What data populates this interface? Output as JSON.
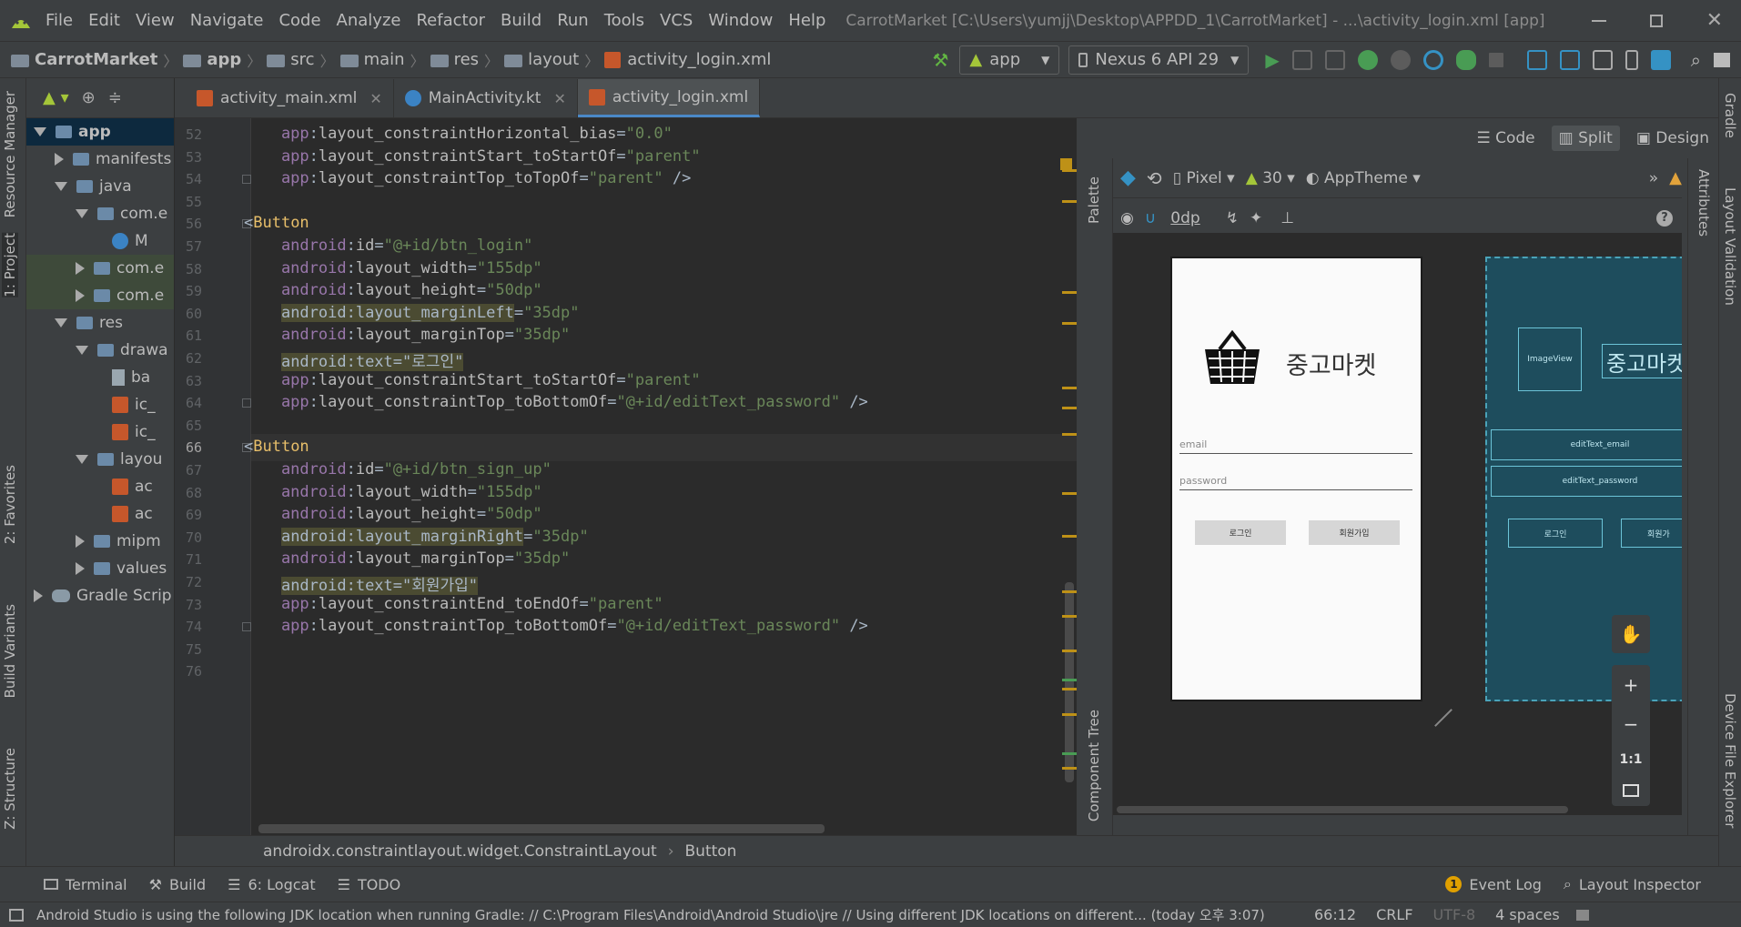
{
  "menu": {
    "items": [
      "File",
      "Edit",
      "View",
      "Navigate",
      "Code",
      "Analyze",
      "Refactor",
      "Build",
      "Run",
      "Tools",
      "VCS",
      "Window",
      "Help"
    ],
    "window_title": "CarrotMarket [C:\\Users\\yumjj\\Desktop\\APPDD_1\\CarrotMarket] - ...\\activity_login.xml [app]"
  },
  "breadcrumb": [
    "CarrotMarket",
    "app",
    "src",
    "main",
    "res",
    "layout",
    "activity_login.xml"
  ],
  "run_config": {
    "module": "app",
    "device": "Nexus 6 API 29"
  },
  "project": {
    "items": [
      {
        "label": "app",
        "indent": 0,
        "tri": "down",
        "icon": "folder",
        "selected": true
      },
      {
        "label": "manifests",
        "indent": 1,
        "tri": "right",
        "icon": "folder"
      },
      {
        "label": "java",
        "indent": 1,
        "tri": "down",
        "icon": "folder"
      },
      {
        "label": "com.e",
        "indent": 2,
        "tri": "down",
        "icon": "folder"
      },
      {
        "label": "M",
        "indent": 3,
        "tri": "none",
        "icon": "kotlin"
      },
      {
        "label": "com.e",
        "indent": 2,
        "tri": "right",
        "icon": "folder",
        "shade": true
      },
      {
        "label": "com.e",
        "indent": 2,
        "tri": "right",
        "icon": "folder",
        "shade": true
      },
      {
        "label": "res",
        "indent": 1,
        "tri": "down",
        "icon": "folder"
      },
      {
        "label": "drawa",
        "indent": 2,
        "tri": "down",
        "icon": "folder"
      },
      {
        "label": "ba",
        "indent": 3,
        "tri": "none",
        "icon": "file"
      },
      {
        "label": "ic_",
        "indent": 3,
        "tri": "none",
        "icon": "xml"
      },
      {
        "label": "ic_",
        "indent": 3,
        "tri": "none",
        "icon": "xml"
      },
      {
        "label": "layou",
        "indent": 2,
        "tri": "down",
        "icon": "folder"
      },
      {
        "label": "ac",
        "indent": 3,
        "tri": "none",
        "icon": "xml"
      },
      {
        "label": "ac",
        "indent": 3,
        "tri": "none",
        "icon": "xml"
      },
      {
        "label": "mipm",
        "indent": 2,
        "tri": "right",
        "icon": "folder"
      },
      {
        "label": "values",
        "indent": 2,
        "tri": "right",
        "icon": "folder"
      },
      {
        "label": "Gradle Scrip",
        "indent": 0,
        "tri": "right",
        "icon": "gradle"
      }
    ]
  },
  "left_tabs": [
    "Resource Manager",
    "1: Project",
    "2: Favorites",
    "Build Variants",
    "Z: Structure"
  ],
  "right_tabs": [
    "Gradle",
    "Layout Validation",
    "Device File Explorer"
  ],
  "editor_tabs": [
    {
      "label": "activity_main.xml",
      "active": false,
      "closable": true
    },
    {
      "label": "MainActivity.kt",
      "active": false,
      "closable": true
    },
    {
      "label": "activity_login.xml",
      "active": true,
      "closable": false
    }
  ],
  "code_lines": [
    {
      "n": "52",
      "tokens": [
        [
          "ns",
          "    app"
        ],
        [
          "pun",
          ":"
        ],
        [
          "at",
          "layout_constraintHorizontal_bias"
        ],
        [
          "pun",
          "="
        ],
        [
          "val",
          "\"0.0\""
        ]
      ]
    },
    {
      "n": "53",
      "tokens": [
        [
          "ns",
          "    app"
        ],
        [
          "pun",
          ":"
        ],
        [
          "at",
          "layout_constraintStart_toStartOf"
        ],
        [
          "pun",
          "="
        ],
        [
          "val",
          "\"parent\""
        ]
      ]
    },
    {
      "n": "54",
      "tokens": [
        [
          "ns",
          "    app"
        ],
        [
          "pun",
          ":"
        ],
        [
          "at",
          "layout_constraintTop_toTopOf"
        ],
        [
          "pun",
          "="
        ],
        [
          "val",
          "\"parent\""
        ],
        [
          "pun",
          " />"
        ]
      ]
    },
    {
      "n": "55",
      "tokens": []
    },
    {
      "n": "56",
      "tokens": [
        [
          "pun",
          "<"
        ],
        [
          "tag",
          "Button"
        ]
      ]
    },
    {
      "n": "57",
      "tokens": [
        [
          "ns",
          "    android"
        ],
        [
          "pun",
          ":"
        ],
        [
          "at",
          "id"
        ],
        [
          "pun",
          "="
        ],
        [
          "val",
          "\"@+id/btn_login\""
        ]
      ]
    },
    {
      "n": "58",
      "tokens": [
        [
          "ns",
          "    android"
        ],
        [
          "pun",
          ":"
        ],
        [
          "at",
          "layout_width"
        ],
        [
          "pun",
          "="
        ],
        [
          "val",
          "\"155dp\""
        ]
      ]
    },
    {
      "n": "59",
      "tokens": [
        [
          "ns",
          "    android"
        ],
        [
          "pun",
          ":"
        ],
        [
          "at",
          "layout_height"
        ],
        [
          "pun",
          "="
        ],
        [
          "val",
          "\"50dp\""
        ]
      ]
    },
    {
      "n": "60",
      "tokens": [
        [
          "pun",
          "    "
        ],
        [
          "hl",
          "android:layout_marginLeft"
        ],
        [
          "pun",
          "="
        ],
        [
          "val",
          "\"35dp\""
        ]
      ]
    },
    {
      "n": "61",
      "tokens": [
        [
          "ns",
          "    android"
        ],
        [
          "pun",
          ":"
        ],
        [
          "at",
          "layout_marginTop"
        ],
        [
          "pun",
          "="
        ],
        [
          "val",
          "\"35dp\""
        ]
      ]
    },
    {
      "n": "62",
      "tokens": [
        [
          "pun",
          "    "
        ],
        [
          "hl",
          "android:text=\"로그인\""
        ]
      ]
    },
    {
      "n": "63",
      "tokens": [
        [
          "ns",
          "    app"
        ],
        [
          "pun",
          ":"
        ],
        [
          "at",
          "layout_constraintStart_toStartOf"
        ],
        [
          "pun",
          "="
        ],
        [
          "val",
          "\"parent\""
        ]
      ]
    },
    {
      "n": "64",
      "tokens": [
        [
          "ns",
          "    app"
        ],
        [
          "pun",
          ":"
        ],
        [
          "at",
          "layout_constraintTop_toBottomOf"
        ],
        [
          "pun",
          "="
        ],
        [
          "val",
          "\"@+id/editText_password\""
        ],
        [
          "pun",
          " />"
        ]
      ]
    },
    {
      "n": "65",
      "tokens": []
    },
    {
      "n": "66",
      "tokens": [
        [
          "pun",
          "<"
        ],
        [
          "tag",
          "Button"
        ]
      ]
    },
    {
      "n": "67",
      "tokens": [
        [
          "ns",
          "    android"
        ],
        [
          "pun",
          ":"
        ],
        [
          "at",
          "id"
        ],
        [
          "pun",
          "="
        ],
        [
          "val",
          "\"@+id/btn_sign_up\""
        ]
      ]
    },
    {
      "n": "68",
      "tokens": [
        [
          "ns",
          "    android"
        ],
        [
          "pun",
          ":"
        ],
        [
          "at",
          "layout_width"
        ],
        [
          "pun",
          "="
        ],
        [
          "val",
          "\"155dp\""
        ]
      ]
    },
    {
      "n": "69",
      "tokens": [
        [
          "ns",
          "    android"
        ],
        [
          "pun",
          ":"
        ],
        [
          "at",
          "layout_height"
        ],
        [
          "pun",
          "="
        ],
        [
          "val",
          "\"50dp\""
        ]
      ]
    },
    {
      "n": "70",
      "tokens": [
        [
          "pun",
          "    "
        ],
        [
          "hl",
          "android:layout_marginRight"
        ],
        [
          "pun",
          "="
        ],
        [
          "val",
          "\"35dp\""
        ]
      ]
    },
    {
      "n": "71",
      "tokens": [
        [
          "ns",
          "    android"
        ],
        [
          "pun",
          ":"
        ],
        [
          "at",
          "layout_marginTop"
        ],
        [
          "pun",
          "="
        ],
        [
          "val",
          "\"35dp\""
        ]
      ]
    },
    {
      "n": "72",
      "tokens": [
        [
          "pun",
          "    "
        ],
        [
          "hl",
          "android:text=\"회원가입\""
        ]
      ]
    },
    {
      "n": "73",
      "tokens": [
        [
          "ns",
          "    app"
        ],
        [
          "pun",
          ":"
        ],
        [
          "at",
          "layout_constraintEnd_toEndOf"
        ],
        [
          "pun",
          "="
        ],
        [
          "val",
          "\"parent\""
        ]
      ]
    },
    {
      "n": "74",
      "tokens": [
        [
          "ns",
          "    app"
        ],
        [
          "pun",
          ":"
        ],
        [
          "at",
          "layout_constraintTop_toBottomOf"
        ],
        [
          "pun",
          "="
        ],
        [
          "val",
          "\"@+id/editText_password\""
        ],
        [
          "pun",
          " />"
        ]
      ]
    },
    {
      "n": "75",
      "tokens": []
    },
    {
      "n": "76",
      "tokens": []
    }
  ],
  "code_breadcrumb": [
    "androidx.constraintlayout.widget.ConstraintLayout",
    "Button"
  ],
  "view_modes": {
    "code": "Code",
    "split": "Split",
    "design": "Design"
  },
  "design_toolbar": {
    "device": "Pixel",
    "api": "30",
    "theme": "AppTheme",
    "margin": "0dp"
  },
  "side_panels": {
    "palette": "Palette",
    "component_tree": "Component Tree",
    "attributes": "Attributes"
  },
  "phone_preview": {
    "app_title": "중고마켓",
    "email_hint": "email",
    "password_hint": "password",
    "login_btn": "로그인",
    "signup_btn": "회원가입"
  },
  "blueprint": {
    "imageview": "ImageView",
    "title": "중고마켓",
    "email": "editText_email",
    "password": "editText_password",
    "login": "로그인",
    "signup": "회원가"
  },
  "zoom": {
    "one_to_one": "1:1"
  },
  "tool_windows": [
    "Terminal",
    "Build",
    "6: Logcat",
    "TODO"
  ],
  "tool_windows_right": [
    "Event Log",
    "Layout Inspector"
  ],
  "event_log_count": "1",
  "status": {
    "message": "Android Studio is using the following JDK location when running Gradle: // C:\\Program Files\\Android\\Android Studio\\jre // Using different JDK locations on different... (today 오후 3:07)",
    "position": "66:12",
    "line_sep": "CRLF",
    "encoding": "UTF-8",
    "indent": "4 spaces"
  }
}
